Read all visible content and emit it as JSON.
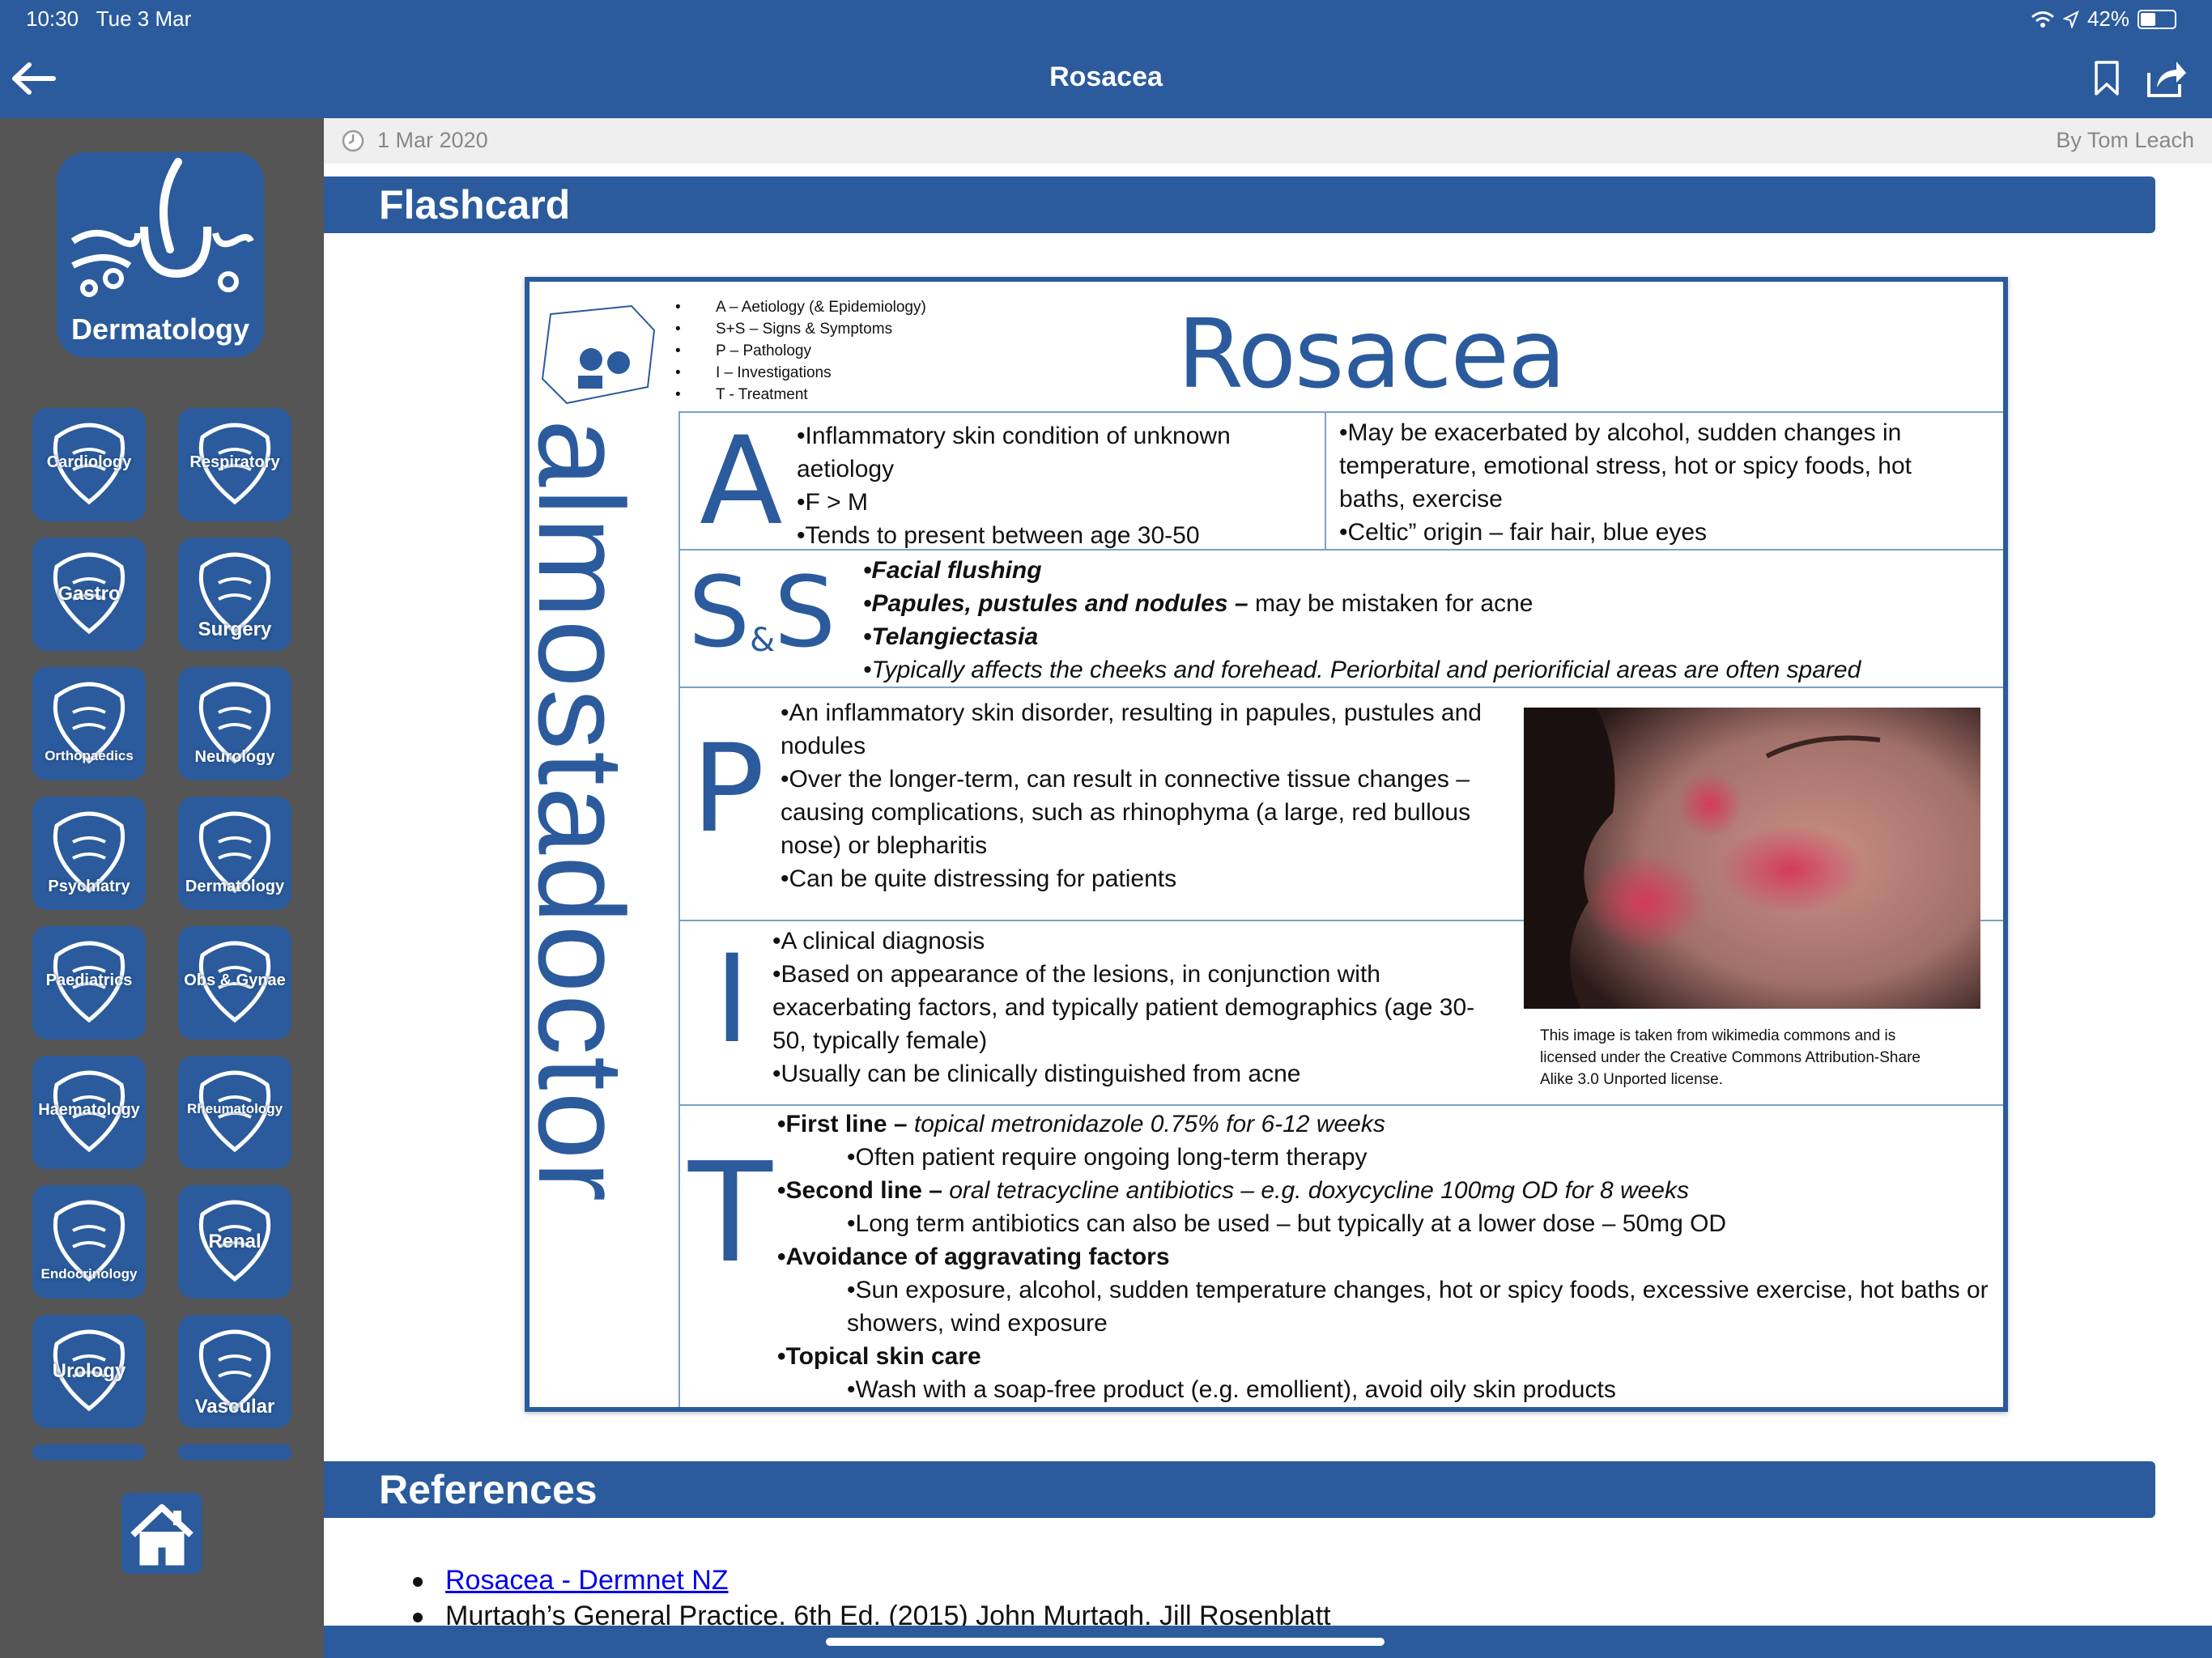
{
  "status": {
    "time": "10:30",
    "date": "Tue 3 Mar",
    "battery": "42%",
    "battery_level": 0.42
  },
  "nav": {
    "title": "Rosacea"
  },
  "sidebar": {
    "featured": "Dermatology",
    "categories": [
      {
        "label": "Cardiology"
      },
      {
        "label": "Respiratory"
      },
      {
        "label": "Gastro"
      },
      {
        "label": "Surgery"
      },
      {
        "label": "Orthopaedics"
      },
      {
        "label": "Neurology"
      },
      {
        "label": "Psychiatry"
      },
      {
        "label": "Dermatology"
      },
      {
        "label": "Paediatrics"
      },
      {
        "label": "Obs & Gynae"
      },
      {
        "label": "Haematology"
      },
      {
        "label": "Rheumatology"
      },
      {
        "label": "Endocrinology"
      },
      {
        "label": "Renal"
      },
      {
        "label": "Urology"
      },
      {
        "label": "Vascular"
      }
    ]
  },
  "meta": {
    "date": "1 Mar 2020",
    "author": "By Tom Leach"
  },
  "sections": {
    "flashcard": "Flashcard",
    "references": "References"
  },
  "card": {
    "brand": "almostadoctor",
    "key": [
      "A – Aetiology (& Epidemiology)",
      "S+S – Signs & Symptoms",
      "P – Pathology",
      "I – Investigations",
      "T - Treatment"
    ],
    "title": "Rosacea",
    "letters": {
      "a": "A",
      "s1": "S",
      "amp": "&",
      "s2": "S",
      "p": "P",
      "i": "I",
      "t": "T"
    },
    "a_left": [
      "•Inflammatory skin condition of unknown aetiology",
      "•F > M",
      "•Tends to present between age 30-50"
    ],
    "a_right": [
      "•May be exacerbated by alcohol, sudden changes in temperature, emotional stress, hot or spicy foods, hot baths, exercise",
      "•Celtic” origin – fair hair, blue eyes"
    ],
    "ss": {
      "l1": "•Facial flushing",
      "l2_bold": "•Papules, pustules and nodules –",
      "l2_rest": " may be mistaken for acne",
      "l3": "•Telangiectasia",
      "l4": "•Typically affects the cheeks and forehead. Periorbital and periorificial areas are often spared"
    },
    "p": [
      "•An inflammatory skin disorder, resulting in papules, pustules and nodules",
      "•Over the longer-term, can result in connective tissue changes – causing complications, such as rhinophyma (a large, red bullous nose) or blepharitis",
      "•Can be quite distressing for patients"
    ],
    "i": [
      "•A clinical diagnosis",
      "•Based on appearance of the lesions, in conjunction with exacerbating factors, and typically patient demographics (age 30-50, typically female)",
      "•Usually can be clinically distinguished from acne"
    ],
    "credit": "This image is taken from wikimedia commons and is licensed under the Creative Commons Attribution-Share Alike 3.0 Unported license.",
    "t": {
      "first_bold": "•First line –",
      "first_it": " topical metronidazole 0.75% for 6-12 weeks",
      "first_sub": "•Often patient require ongoing long-term therapy",
      "second_bold": "•Second line –",
      "second_it": " oral tetracycline antibiotics – e.g. doxycycline 100mg OD for 8 weeks",
      "second_sub": "•Long term antibiotics can also be used – but typically at a lower dose – 50mg OD",
      "avoid_bold": "•Avoidance of aggravating factors",
      "avoid_sub": "•Sun exposure, alcohol, sudden temperature changes, hot or spicy foods, excessive exercise, hot baths or showers, wind exposure",
      "topical_bold": "•Topical skin care",
      "topical_sub": "•Wash with a soap-free product (e.g. emollient), avoid oily skin products"
    }
  },
  "references": [
    {
      "text": "Rosacea - Dermnet NZ",
      "link": true
    },
    {
      "text": "Murtagh’s General Practice. 6th Ed. (2015) John Murtagh. Jill Rosenblatt",
      "link": false
    }
  ]
}
